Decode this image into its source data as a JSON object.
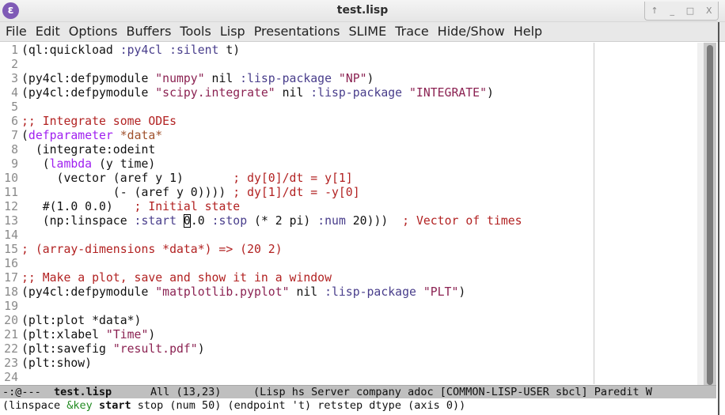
{
  "window": {
    "title": "test.lisp",
    "logo": "emacs-logo",
    "buttons": [
      "↑",
      "_",
      "□",
      "X"
    ]
  },
  "menu": [
    "File",
    "Edit",
    "Options",
    "Buffers",
    "Tools",
    "Lisp",
    "Presentations",
    "SLIME",
    "Trace",
    "Hide/Show",
    "Help"
  ],
  "colors": {
    "keyword": "#483d8b",
    "string": "#8b2252",
    "comment": "#b22222",
    "builtin": "#a020f0",
    "variable": "#a0522d"
  },
  "code": [
    [
      [
        "(ql:quickload ",
        "n"
      ],
      [
        ":py4cl",
        "k"
      ],
      [
        " ",
        "n"
      ],
      [
        ":silent",
        "k"
      ],
      [
        " t)",
        "n"
      ]
    ],
    [],
    [
      [
        "(py4cl:defpymodule ",
        "n"
      ],
      [
        "\"numpy\"",
        "s"
      ],
      [
        " nil ",
        "n"
      ],
      [
        ":lisp-package",
        "k"
      ],
      [
        " ",
        "n"
      ],
      [
        "\"NP\"",
        "s"
      ],
      [
        ")",
        "n"
      ]
    ],
    [
      [
        "(py4cl:defpymodule ",
        "n"
      ],
      [
        "\"scipy.integrate\"",
        "s"
      ],
      [
        " nil ",
        "n"
      ],
      [
        ":lisp-package",
        "k"
      ],
      [
        " ",
        "n"
      ],
      [
        "\"INTEGRATE\"",
        "s"
      ],
      [
        ")",
        "n"
      ]
    ],
    [],
    [
      [
        ";; Integrate some ODEs",
        "c"
      ]
    ],
    [
      [
        "(",
        "n"
      ],
      [
        "defparameter",
        "d"
      ],
      [
        " ",
        "n"
      ],
      [
        "*data*",
        "v"
      ]
    ],
    [
      [
        "  (integrate:odeint",
        "n"
      ]
    ],
    [
      [
        "   (",
        "n"
      ],
      [
        "lambda",
        "d"
      ],
      [
        " (y time)",
        "n"
      ]
    ],
    [
      [
        "     (vector (aref y 1)       ",
        "n"
      ],
      [
        "; dy[0]/dt = y[1]",
        "c"
      ]
    ],
    [
      [
        "             (- (aref y 0)))) ",
        "n"
      ],
      [
        "; dy[1]/dt = -y[0]",
        "c"
      ]
    ],
    [
      [
        "   #(1.0 0.0)   ",
        "n"
      ],
      [
        "; Initial state",
        "c"
      ]
    ],
    [
      [
        "   (np:linspace ",
        "n"
      ],
      [
        ":start",
        "k"
      ],
      [
        " ",
        "n"
      ],
      [
        "0",
        "cur"
      ],
      [
        ".0 ",
        "n"
      ],
      [
        ":stop",
        "k"
      ],
      [
        " (* 2 pi) ",
        "n"
      ],
      [
        ":num",
        "k"
      ],
      [
        " 20)))  ",
        "n"
      ],
      [
        "; Vector of times",
        "c"
      ]
    ],
    [],
    [
      [
        "; (array-dimensions *data*) => (20 2)",
        "c"
      ]
    ],
    [],
    [
      [
        ";; Make a plot, save and show it in a window",
        "c"
      ]
    ],
    [
      [
        "(py4cl:defpymodule ",
        "n"
      ],
      [
        "\"matplotlib.pyplot\"",
        "s"
      ],
      [
        " nil ",
        "n"
      ],
      [
        ":lisp-package",
        "k"
      ],
      [
        " ",
        "n"
      ],
      [
        "\"PLT\"",
        "s"
      ],
      [
        ")",
        "n"
      ]
    ],
    [],
    [
      [
        "(plt:plot *data*)",
        "n"
      ]
    ],
    [
      [
        "(plt:xlabel ",
        "n"
      ],
      [
        "\"Time\"",
        "s"
      ],
      [
        ")",
        "n"
      ]
    ],
    [
      [
        "(plt:savefig ",
        "n"
      ],
      [
        "\"result.pdf\"",
        "s"
      ],
      [
        ")",
        "n"
      ]
    ],
    [
      [
        "(plt:show)",
        "n"
      ]
    ],
    []
  ],
  "modeline": {
    "status": "-:@---  ",
    "buffer": "test.lisp",
    "position": "      All (13,23)     ",
    "modes": "(Lisp hs Server company adoc [COMMON-LISP-USER sbcl] Paredit W"
  },
  "minibuffer": {
    "pre": "(linspace ",
    "key": "&key",
    "sp": " ",
    "start": "start",
    "post": " stop (num 50) (endpoint 't) retstep dtype (axis 0))"
  }
}
